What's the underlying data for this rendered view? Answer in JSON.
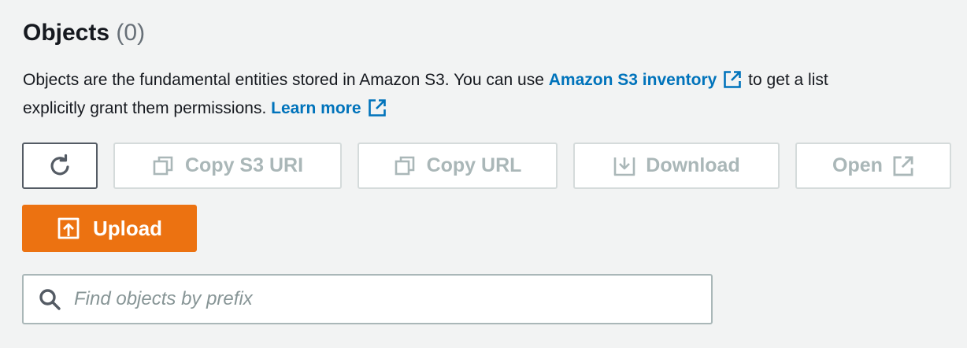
{
  "header": {
    "title": "Objects",
    "count": "(0)"
  },
  "description": {
    "line1_text": "Objects are the fundamental entities stored in Amazon S3. You can use ",
    "inventory_link": "Amazon S3 inventory",
    "line1_rest": " to get a list",
    "line2_text": "explicitly grant them permissions. ",
    "learn_more_link": "Learn more"
  },
  "toolbar": {
    "copy_s3_uri_label": "Copy S3 URI",
    "copy_url_label": "Copy URL",
    "download_label": "Download",
    "open_label": "Open",
    "upload_label": "Upload"
  },
  "search": {
    "placeholder": "Find objects by prefix",
    "value": ""
  },
  "colors": {
    "accent_orange": "#ec7211",
    "link_blue": "#0073bb",
    "disabled_gray": "#aab7b8",
    "background": "#f2f3f3"
  },
  "icons": {
    "refresh": "refresh-icon",
    "copy": "copy-icon",
    "download": "download-icon",
    "open": "external-link-icon",
    "upload": "upload-icon",
    "search": "search-icon"
  }
}
